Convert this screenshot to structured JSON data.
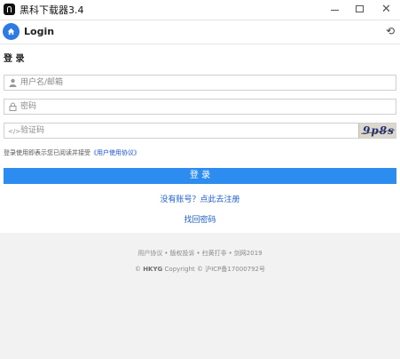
{
  "window": {
    "title": "黑科下载器3.4",
    "controls": {
      "minimize": "minimize",
      "maximize": "maximize",
      "close": "✕"
    }
  },
  "header": {
    "title": "Login",
    "home_icon": "home-icon",
    "refresh_icon": "refresh-icon",
    "refresh_glyph": "⟲",
    "accent": "#2c7be5"
  },
  "form": {
    "section_title": "登 录",
    "username_placeholder": "用户名/邮箱",
    "password_placeholder": "密码",
    "captcha_placeholder": "验证码",
    "captcha_image_text": "9p8s",
    "user_icon_glyph": "👤",
    "lock_icon_glyph": "🔒",
    "code_icon_glyph": "</>",
    "agree_text": "登录使用即表示您已阅读并接受",
    "agree_link": "《用户使用协议》",
    "login_button": "登 录",
    "login_button_color": "#2d8cf0",
    "register_link": "没有账号？点此去注册",
    "forgot_link": "找回密码"
  },
  "footer": {
    "links": [
      "用户协议",
      "版权投诉",
      "扫黄打非",
      "剑网2019"
    ],
    "separator": "•",
    "copyright_symbol": "©",
    "brand": "HKYG",
    "copyright_rest": "Copyright © 沪ICP备17000792号"
  }
}
